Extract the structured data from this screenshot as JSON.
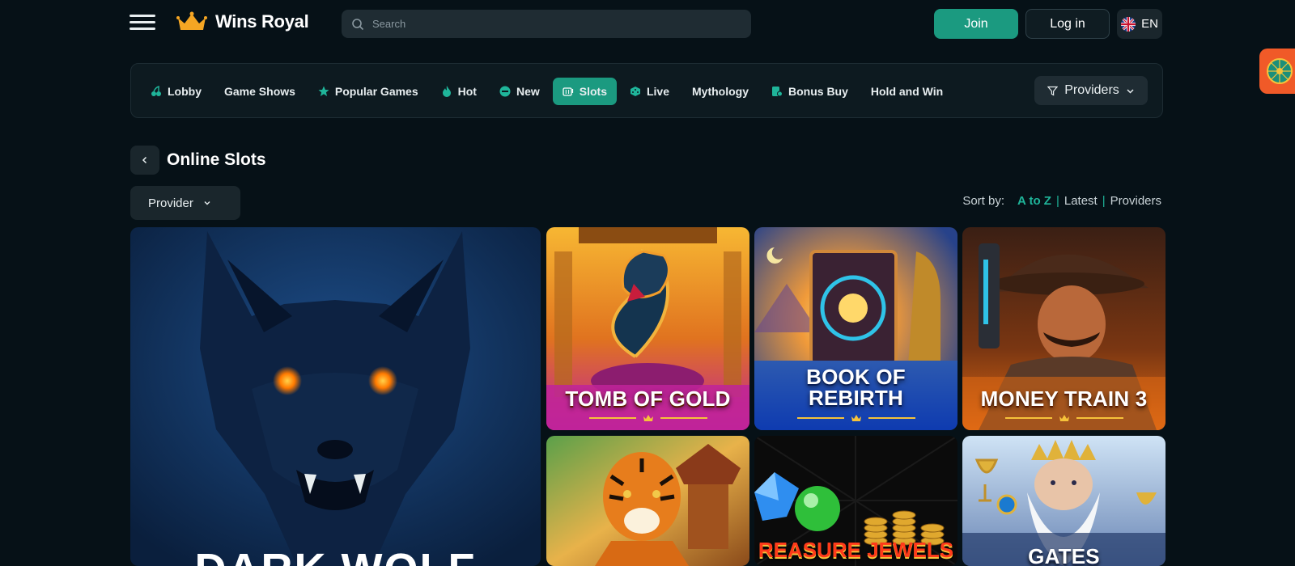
{
  "header": {
    "brand": "Wins Royal",
    "search_placeholder": "Search",
    "join_label": "Join",
    "login_label": "Log in",
    "language": "EN"
  },
  "nav": {
    "items": [
      {
        "label": "Lobby",
        "icon": "cherries-icon",
        "active": false
      },
      {
        "label": "Game Shows",
        "icon": "",
        "active": false
      },
      {
        "label": "Popular Games",
        "icon": "star-icon",
        "active": false
      },
      {
        "label": "Hot",
        "icon": "flame-icon",
        "active": false
      },
      {
        "label": "New",
        "icon": "new-badge-icon",
        "active": false
      },
      {
        "label": "Slots",
        "icon": "slot-machine-icon",
        "active": true
      },
      {
        "label": "Live",
        "icon": "dice-icon",
        "active": false
      },
      {
        "label": "Mythology",
        "icon": "",
        "active": false
      },
      {
        "label": "Bonus Buy",
        "icon": "bonus-icon",
        "active": false
      },
      {
        "label": "Hold and Win",
        "icon": "",
        "active": false
      }
    ],
    "providers_label": "Providers"
  },
  "page": {
    "title": "Online Slots",
    "provider_filter": "Provider",
    "sort_label": "Sort by:",
    "sort_options": [
      "A to Z",
      "Latest",
      "Providers"
    ],
    "sort_active": "A to Z"
  },
  "games": [
    {
      "title": "DARK WOLF",
      "featured": true
    },
    {
      "title": "TOMB OF GOLD"
    },
    {
      "title_line1": "BOOK OF",
      "title_line2": "REBIRTH",
      "title": "BOOK OF REBIRTH"
    },
    {
      "title": "MONEY TRAIN 3"
    },
    {
      "title": ""
    },
    {
      "title": "REASURE JEWELS"
    },
    {
      "title": "GATES"
    }
  ],
  "colors": {
    "background": "#061117",
    "accent": "#1b9a80",
    "accent_text": "#1fb59a",
    "panel": "#0d1a20"
  }
}
